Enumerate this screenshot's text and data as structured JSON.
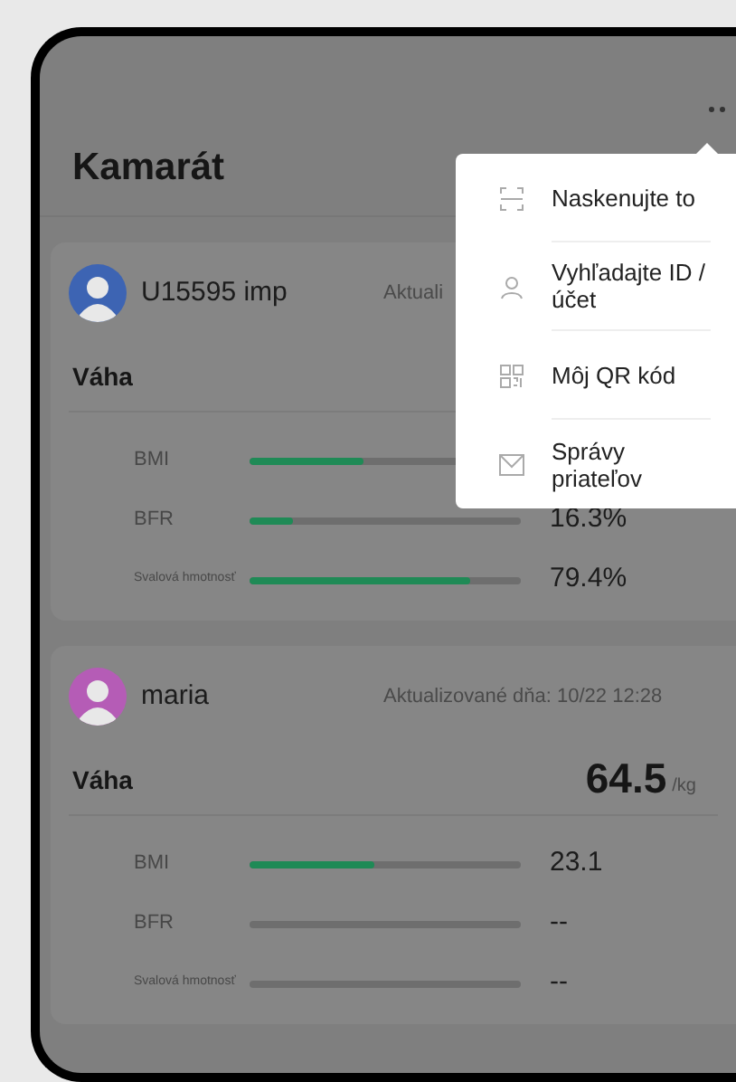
{
  "header": {
    "title": "Kamarát"
  },
  "friends": [
    {
      "name": "U15595 imp",
      "updated": "Aktuali",
      "color": "#3d64b3",
      "weight_label": "Váha",
      "metrics": [
        {
          "label": "BMI",
          "level": 0.42
        },
        {
          "label": "BFR",
          "level": 0.16,
          "reading": "16.3%"
        },
        {
          "label": "Svalová hmotnosť",
          "level": 0.81,
          "reading": "79.4%"
        }
      ]
    },
    {
      "name": "maria",
      "updated": "Aktualizované dňa: 10/22 12:28",
      "color": "#b55cb6",
      "weight_label": "Váha",
      "weight": "64.5",
      "unit": "/kg",
      "metrics": [
        {
          "label": "BMI",
          "level": 0.46,
          "reading": "23.1"
        },
        {
          "label": "BFR",
          "level": 0,
          "reading": "--"
        },
        {
          "label": "Svalová hmotnosť",
          "level": 0,
          "reading": "--"
        }
      ]
    }
  ],
  "menu": {
    "items": [
      {
        "kind": "scan",
        "label": "Naskenujte to"
      },
      {
        "kind": "search",
        "label": "Vyhľadajte ID / účet"
      },
      {
        "kind": "qr",
        "label": "Môj QR kód"
      },
      {
        "kind": "mail",
        "label": "Správy priateľov"
      }
    ]
  }
}
